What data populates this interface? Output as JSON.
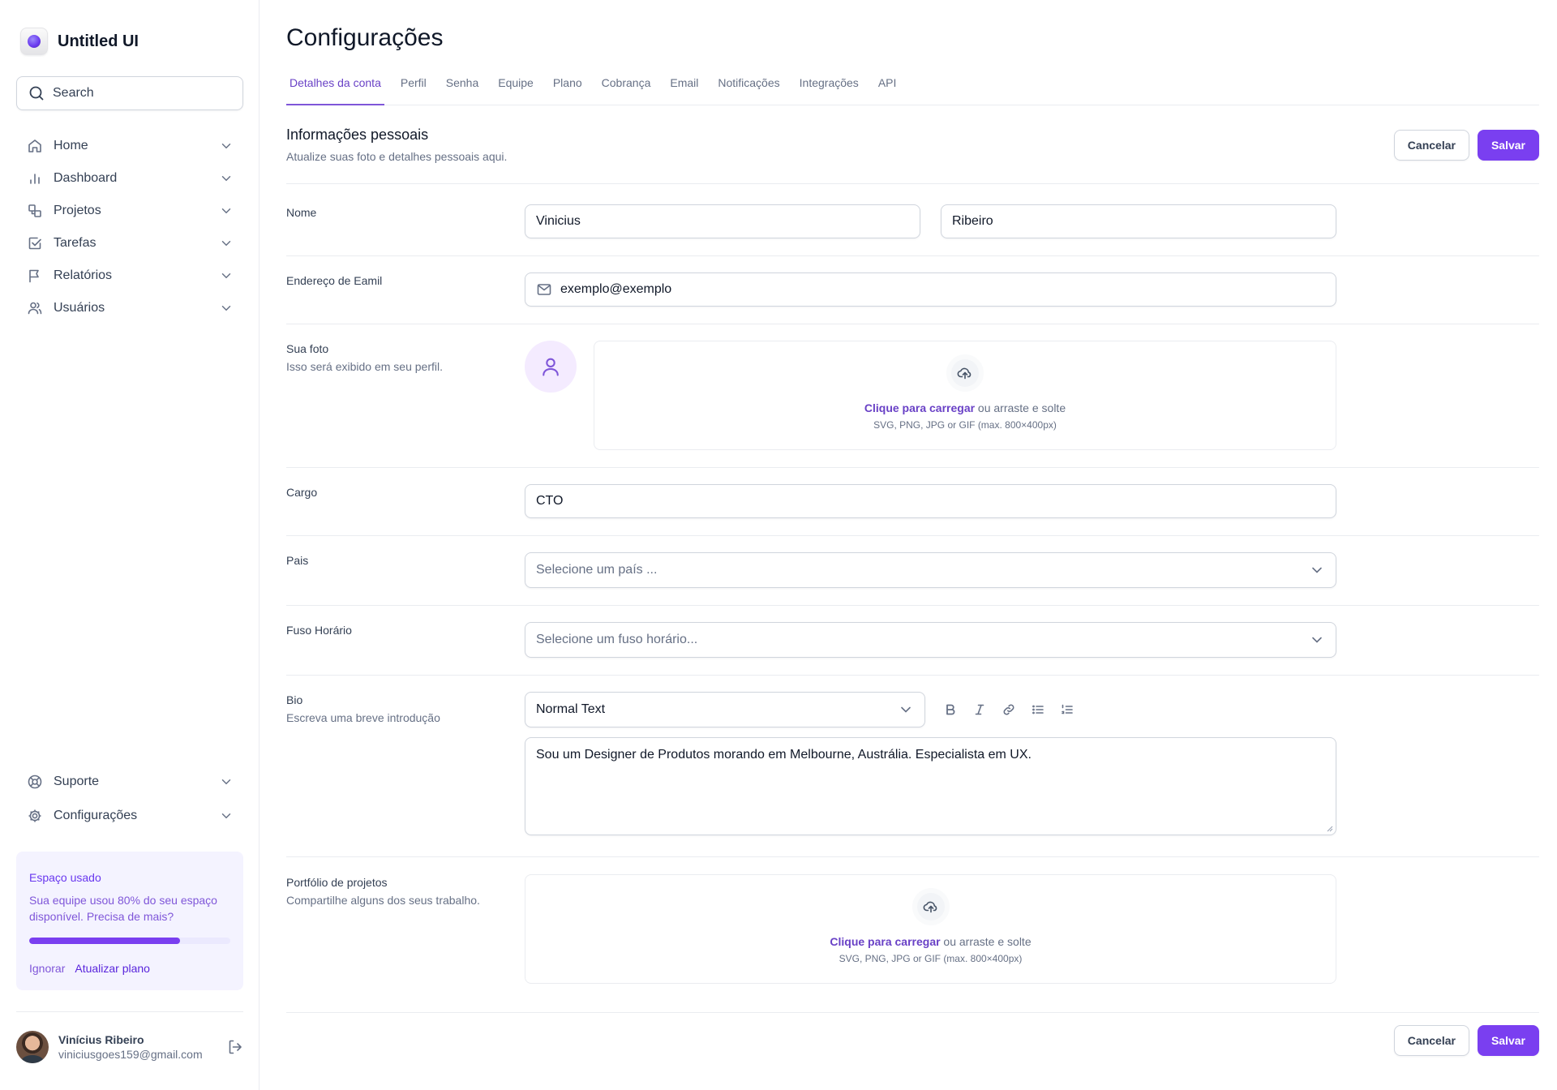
{
  "brand": {
    "name": "Untitled UI"
  },
  "search": {
    "placeholder": "Search"
  },
  "nav": {
    "items": [
      {
        "label": "Home",
        "icon": "home-icon"
      },
      {
        "label": "Dashboard",
        "icon": "bar-chart-icon"
      },
      {
        "label": "Projetos",
        "icon": "layers-icon"
      },
      {
        "label": "Tarefas",
        "icon": "check-square-icon"
      },
      {
        "label": "Relatórios",
        "icon": "flag-icon"
      },
      {
        "label": "Usuários",
        "icon": "users-icon"
      }
    ],
    "bottom": [
      {
        "label": "Suporte",
        "icon": "life-buoy-icon"
      },
      {
        "label": "Configurações",
        "icon": "settings-icon"
      }
    ]
  },
  "usage": {
    "title": "Espaço usado",
    "text": "Sua equipe usou 80% do seu espaço disponível. Precisa de mais?",
    "progress_percent": 75,
    "dismiss": "Ignorar",
    "upgrade": "Atualizar plano"
  },
  "account": {
    "name": "Vinícius Ribeiro",
    "email": "viniciusgoes159@gmail.com"
  },
  "page": {
    "title": "Configurações"
  },
  "tabs": [
    "Detalhes da conta",
    "Perfil",
    "Senha",
    "Equipe",
    "Plano",
    "Cobrança",
    "Email",
    "Notificações",
    "Integrações",
    "API"
  ],
  "section": {
    "title": "Informações pessoais",
    "subtitle": "Atualize suas foto e detalhes pessoais aqui."
  },
  "actions": {
    "cancel": "Cancelar",
    "save": "Salvar"
  },
  "form": {
    "name": {
      "label": "Nome",
      "first": "Vinicius",
      "last": "Ribeiro"
    },
    "email": {
      "label": "Endereço de Eamil",
      "value": "exemplo@exemplo"
    },
    "photo": {
      "label": "Sua foto",
      "hint": "Isso será exibido em seu perfil.",
      "upload_link": "Clique para carregar",
      "upload_text": " ou arraste e solte",
      "upload_hint": "SVG, PNG, JPG or GIF (max. 800×400px)"
    },
    "role": {
      "label": "Cargo",
      "value": "CTO"
    },
    "country": {
      "label": "Pais",
      "placeholder": "Selecione um país ..."
    },
    "timezone": {
      "label": "Fuso Horário",
      "placeholder": "Selecione um fuso horário..."
    },
    "bio": {
      "label": "Bio",
      "hint": "Escreva uma breve introdução",
      "format": "Normal Text",
      "value": "Sou um Designer de Produtos morando em Melbourne, Austrália. Especialista em UX."
    },
    "portfolio": {
      "label": "Portfólio de projetos",
      "hint": "Compartilhe alguns dos seus trabalho.",
      "upload_link": "Clique para carregar",
      "upload_text": " ou arraste e solte",
      "upload_hint": "SVG, PNG, JPG or GIF (max. 800×400px)"
    }
  },
  "colors": {
    "accent": "#7a3ff0",
    "accent_text": "#6941c6",
    "border": "#d0d5dd",
    "divider": "#eaecf0"
  }
}
